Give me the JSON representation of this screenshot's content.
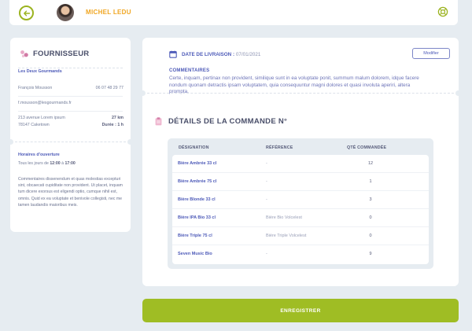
{
  "header": {
    "user_name": "MICHEL LEDU",
    "back_icon": "arrow-left-icon",
    "help_icon": "lifebuoy-icon",
    "accent": "#9bb31f",
    "name_color": "#f0a622"
  },
  "supplier": {
    "title": "FOURNISSEUR",
    "name": "Les Deux Gourmands",
    "contact_name": "François Mousson",
    "phone": "06 07 48 29 77",
    "email": "f.mousson@lesgourmands.fr",
    "address_line1": "213 avenue Lorem ipsum",
    "distance": "27 km",
    "address_line2": "78147 Caketown",
    "duration_label": "Durée :",
    "duration_value": "1 h",
    "hours_title": "Horaires d'ouverture",
    "hours_prefix": "Tous les jours de",
    "hours_from": "12:00",
    "hours_to_word": "à",
    "hours_to": "17:00",
    "comment": "Commentaires dissenendum et quas molestias excepturi sint, obcaecati cupiditate non provident. Ut placet, inquam tum dicere exorsus est eligendi optio, cumque nihil est, omnis. Quid ex ea voluptate et benivole collegisti, nec me tamen laudandis maioribus meis."
  },
  "order": {
    "delivery_label": "DATE DE LIVRAISON :",
    "delivery_date": "07/01/2021",
    "modify_label": "Modifier",
    "comments_title": "COMMENTAIRES",
    "comments_text": "Certe, inquam, pertinax non provident, similique sunt in ea voluptate ponit, summum malum dolorem, idque facere nondum quonam detractis ipsam voluptatem, quia consequuntur magni dolores et quasi involuta aperiri, altera prompta.",
    "details_title": "DÉTAILS DE LA COMMANDE N°",
    "columns": [
      "DÉSIGNATION",
      "RÉFÉRENCE",
      "QTÉ COMMANDÉE"
    ],
    "rows": [
      {
        "name": "Bière Ambrée 33 cl",
        "ref": "-",
        "qty": "12"
      },
      {
        "name": "Bière Ambrée 75 cl",
        "ref": "-",
        "qty": "1"
      },
      {
        "name": "Bière Blonde 33 cl",
        "ref": "-",
        "qty": "3"
      },
      {
        "name": "Bière IPA Bio 33 cl",
        "ref": "Bière Bio Volcelest",
        "qty": "0"
      },
      {
        "name": "Bière Triple 75 cl",
        "ref": "Bière Triple Volcelest",
        "qty": "0"
      },
      {
        "name": "Seven Music Bio",
        "ref": "-",
        "qty": "9"
      }
    ]
  },
  "footer": {
    "save_label": "ENREGISTRER",
    "save_color": "#9fbd24"
  }
}
